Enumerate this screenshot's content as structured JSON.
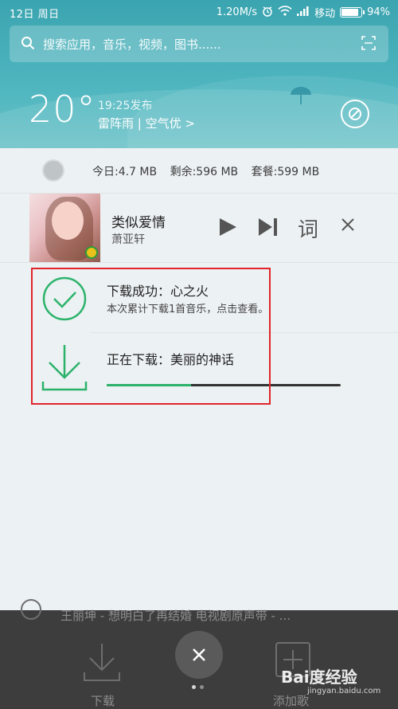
{
  "status_bar": {
    "date": "12日 周日",
    "speed": "1.20M/s",
    "carrier": "移动",
    "battery": "94%",
    "battery_level": 0.94
  },
  "search": {
    "placeholder": "搜索应用，音乐，视频，图书......"
  },
  "weather": {
    "temperature": "20°",
    "published": "19:25发布",
    "condition": "雷阵雨 | 空气优 >"
  },
  "data_usage": {
    "today": "今日:4.7 MB",
    "remaining": "剩余:596 MB",
    "plan": "套餐:599 MB"
  },
  "music": {
    "title": "类似爱情",
    "artist": "萧亚轩",
    "lyrics_label": "词"
  },
  "downloads": {
    "success_title": "下载成功：心之火",
    "success_sub": "本次累计下载1首音乐，点击查看。",
    "progress_title": "正在下载：美丽的神话",
    "progress": 0.36
  },
  "background": {
    "track_text": "王丽坤 - 想明白了再结婚 电视剧原声带 - ...",
    "download_label": "下载",
    "add_label": "添加歌"
  },
  "watermark": {
    "brand": "Bai度经验",
    "url": "jingyan.baidu.com"
  },
  "colors": {
    "accent_green": "#2cb36b",
    "highlight_red": "#e0242a",
    "teal": "#3aa4b0"
  }
}
